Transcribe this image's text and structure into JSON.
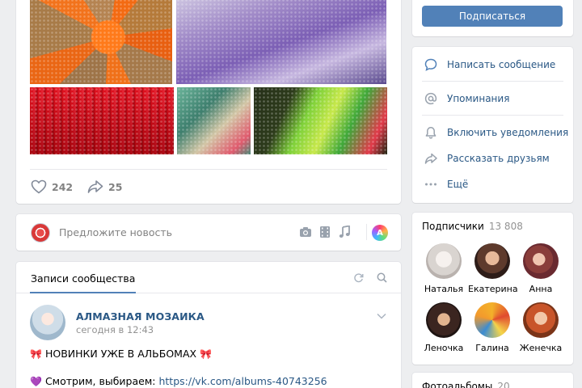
{
  "post": {
    "likes": "242",
    "shares": "25"
  },
  "suggest": {
    "placeholder": "Предложите новость"
  },
  "posts_block": {
    "tab_label": "Записи сообщества",
    "author": "АЛМАЗНАЯ МОЗАИКА",
    "time": "сегодня в 12:43",
    "line1": "НОВИНКИ УЖЕ В АЛЬБОМАХ",
    "line2_prefix": "Смотрим, выбираем:",
    "line2_link": "https://vk.com/albums-40743256"
  },
  "sidebar": {
    "subscribe_label": "Подписаться",
    "menu": [
      {
        "label": "Написать сообщение",
        "icon": "message-icon"
      },
      {
        "label": "Упоминания",
        "icon": "at-icon"
      },
      {
        "label": "Включить уведомления",
        "icon": "bell-icon"
      },
      {
        "label": "Рассказать друзьям",
        "icon": "share-icon"
      },
      {
        "label": "Ещё",
        "icon": "more-icon"
      }
    ],
    "subscribers": {
      "title": "Подписчики",
      "count": "13 808",
      "people": [
        {
          "name": "Наталья"
        },
        {
          "name": "Екатерина"
        },
        {
          "name": "Анна"
        },
        {
          "name": "Леночка"
        },
        {
          "name": "Галина"
        },
        {
          "name": "Женечка"
        }
      ]
    },
    "albums": {
      "title": "Фотоальбомы",
      "count": "20"
    }
  },
  "colors": {
    "accent": "#5181b8",
    "link": "#2a5885",
    "background": "#edeef0"
  }
}
